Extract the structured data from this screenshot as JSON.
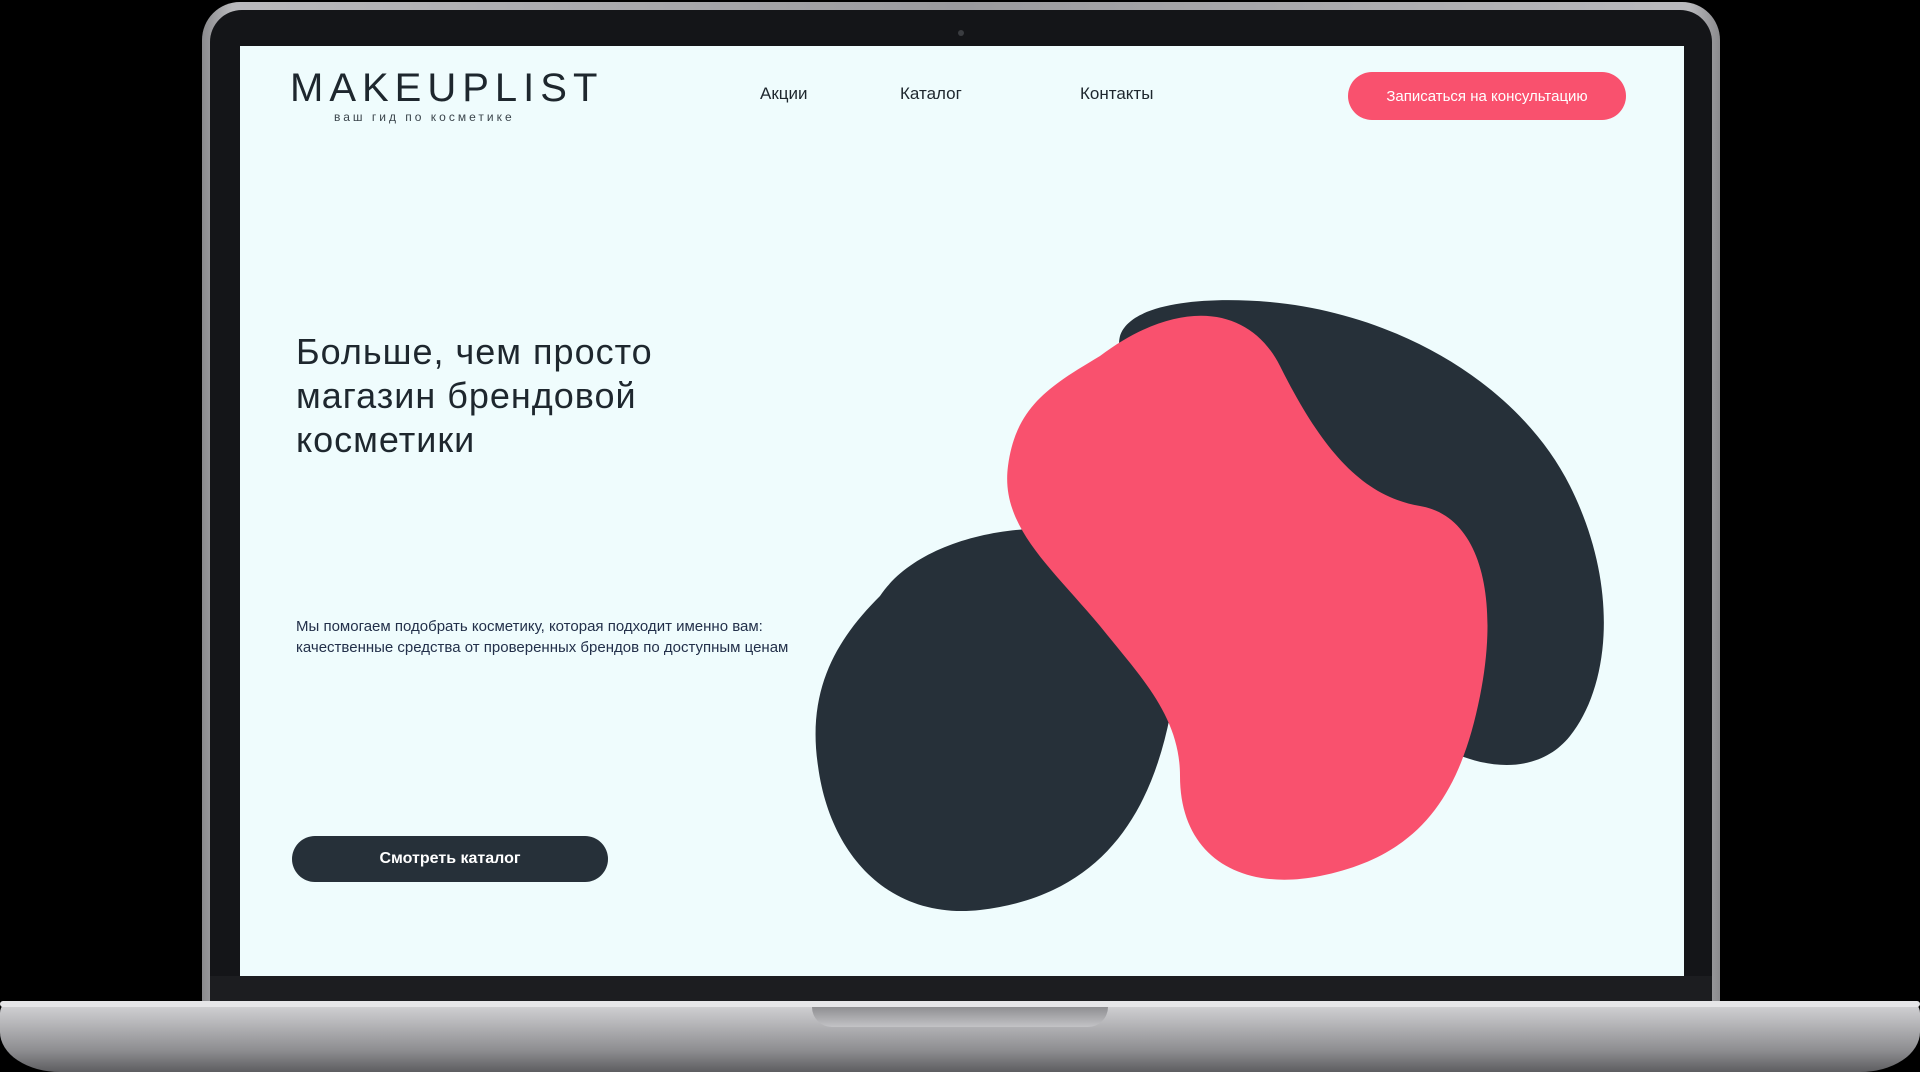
{
  "brand": {
    "title": "MAKEUPLIST",
    "subtitle": "ваш гид по косметике"
  },
  "nav": {
    "links": [
      "Акции",
      "Каталог",
      "Контакты"
    ]
  },
  "header": {
    "cta_label": "Записаться на консультацию"
  },
  "hero": {
    "title_line_1": "Больше, чем просто",
    "title_line_2": "магазин брендовой",
    "title_line_3": "косметики",
    "text": "Мы помогаем подобрать косметику, которая подходит именно вам: качественные средства от проверенных брендов по доступным ценам",
    "cta_label": "Смотреть каталог"
  },
  "colors": {
    "screen_bg": "#effcfd",
    "accent": "#f9516e",
    "dark": "#263039"
  }
}
